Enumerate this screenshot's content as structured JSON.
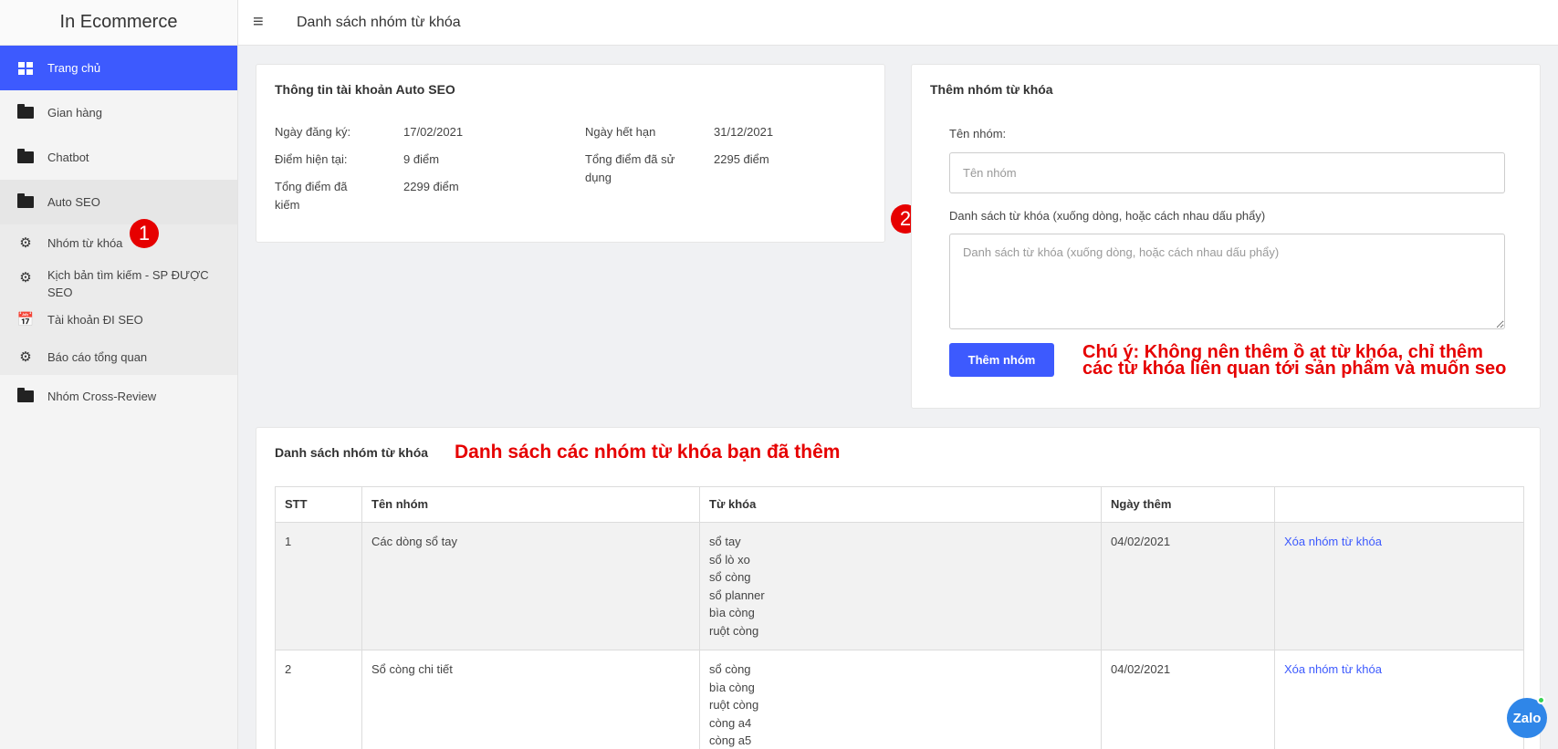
{
  "brand": "In Ecommerce",
  "sidebar": {
    "items": [
      {
        "label": "Trang chủ"
      },
      {
        "label": "Gian hàng"
      },
      {
        "label": "Chatbot"
      },
      {
        "label": "Auto SEO"
      },
      {
        "label": "Nhóm từ khóa"
      },
      {
        "label": "Kịch bản tìm kiếm - SP ĐƯỢC SEO"
      },
      {
        "label": "Tài khoản ĐI SEO"
      },
      {
        "label": "Báo cáo tổng quan"
      },
      {
        "label": "Nhóm Cross-Review"
      }
    ]
  },
  "header": {
    "title": "Danh sách nhóm từ khóa"
  },
  "account": {
    "title": "Thông tin tài khoản Auto SEO",
    "reg_label": "Ngày đăng ký:",
    "reg_value": "17/02/2021",
    "exp_label": "Ngày hết hạn",
    "exp_value": "31/12/2021",
    "points_label": "Điểm hiện tại:",
    "points_value": "9 điểm",
    "used_label": "Tổng điểm đã sử dụng",
    "used_value": "2295 điểm",
    "earned_label": "Tổng điểm đã kiếm",
    "earned_value": "2299 điểm"
  },
  "add_group": {
    "title": "Thêm nhóm từ khóa",
    "name_label": "Tên nhóm:",
    "name_placeholder": "Tên nhóm",
    "keywords_label": "Danh sách từ khóa (xuống dòng, hoặc cách nhau dấu phẩy)",
    "keywords_placeholder": "Danh sách từ khóa (xuống dòng, hoặc cách nhau dấu phẩy)",
    "submit_label": "Thêm nhóm"
  },
  "annotations": {
    "badge1": "1",
    "badge2": "2",
    "note": "Chú ý: Không nên thêm ồ ạt từ khóa, chỉ thêm các từ khóa liên quan tới sản phẩm và muốn seo",
    "list_note": "Danh sách các nhóm từ khóa bạn đã thêm"
  },
  "group_list": {
    "title": "Danh sách nhóm từ khóa",
    "columns": [
      "STT",
      "Tên nhóm",
      "Từ khóa",
      "Ngày thêm",
      ""
    ],
    "rows": [
      {
        "stt": "1",
        "name": "Các dòng sổ tay",
        "keywords": [
          "sổ tay",
          "sổ lò xo",
          "sổ còng",
          "sổ planner",
          "bìa còng",
          "ruột còng"
        ],
        "date": "04/02/2021",
        "action": "Xóa nhóm từ khóa"
      },
      {
        "stt": "2",
        "name": "Sổ còng chi tiết",
        "keywords": [
          "sổ còng",
          "bìa còng",
          "ruột còng",
          "còng a4",
          "còng a5"
        ],
        "date": "04/02/2021",
        "action": "Xóa nhóm từ khóa"
      }
    ]
  },
  "zalo": "Zalo"
}
